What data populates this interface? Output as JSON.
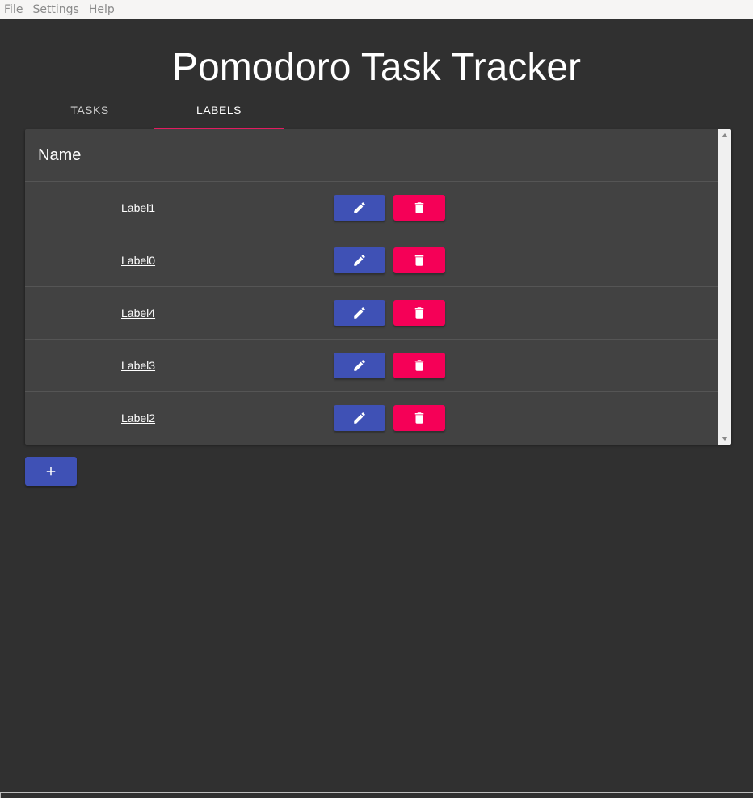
{
  "menubar": {
    "items": [
      "File",
      "Settings",
      "Help"
    ]
  },
  "header": {
    "title": "Pomodoro Task Tracker"
  },
  "tabs": [
    {
      "label": "Tasks",
      "active": false
    },
    {
      "label": "Labels",
      "active": true
    }
  ],
  "table": {
    "column_header": "Name",
    "rows": [
      {
        "name": "Label1"
      },
      {
        "name": "Label0"
      },
      {
        "name": "Label4"
      },
      {
        "name": "Label3"
      },
      {
        "name": "Label2"
      }
    ]
  },
  "icons": {
    "edit": "pencil-icon",
    "delete": "trash-icon",
    "add": "plus-icon"
  },
  "colors": {
    "background": "#303030",
    "panel": "#424242",
    "primary": "#3f51b5",
    "secondary": "#f50057",
    "tab_indicator": "#e91e63"
  }
}
